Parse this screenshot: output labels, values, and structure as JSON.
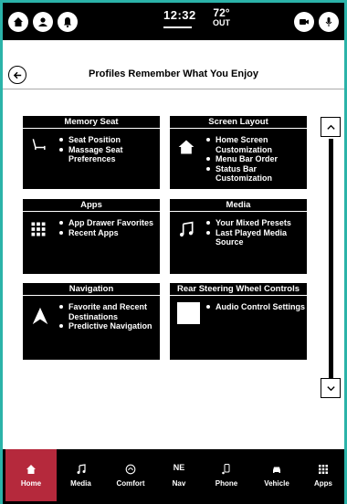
{
  "status_bar": {
    "time": "12:32",
    "temperature": "72°",
    "temperature_label": "OUT"
  },
  "header": {
    "title": "Profiles Remember What You Enjoy"
  },
  "tiles": [
    {
      "title": "Memory Seat",
      "icon": "seat-icon",
      "items": [
        "Seat Position",
        "Massage Seat Preferences"
      ]
    },
    {
      "title": "Screen Layout",
      "icon": "home-icon",
      "items": [
        "Home Screen Customization",
        "Menu Bar Order",
        "Status Bar Customization"
      ]
    },
    {
      "title": "Apps",
      "icon": "grid-icon",
      "items": [
        "App Drawer Favorites",
        "Recent Apps"
      ]
    },
    {
      "title": "Media",
      "icon": "music-note-icon",
      "items": [
        "Your Mixed Presets",
        "Last Played Media Source"
      ]
    },
    {
      "title": "Navigation",
      "icon": "navigation-arrow-icon",
      "items": [
        "Favorite and Recent Destinations",
        "Predictive Navigation"
      ]
    },
    {
      "title": "Rear Steering Wheel Controls",
      "icon": "white-square-icon",
      "items": [
        "Audio Control Settings"
      ]
    }
  ],
  "bottom_nav": [
    {
      "label": "Home",
      "icon": "home-icon",
      "active": true
    },
    {
      "label": "Media",
      "icon": "music-note-icon",
      "active": false
    },
    {
      "label": "Comfort",
      "icon": "climate-icon",
      "active": false
    },
    {
      "label": "Nav",
      "icon": "compass-icon",
      "compass_letters": "NE",
      "active": false
    },
    {
      "label": "Phone",
      "icon": "phone-icon",
      "active": false
    },
    {
      "label": "Vehicle",
      "icon": "car-icon",
      "active": false
    },
    {
      "label": "Apps",
      "icon": "grid-icon",
      "active": false
    }
  ],
  "colors": {
    "frame": "#2bb3a9",
    "active_tab": "#b5293c",
    "tile_background": "#000000"
  }
}
